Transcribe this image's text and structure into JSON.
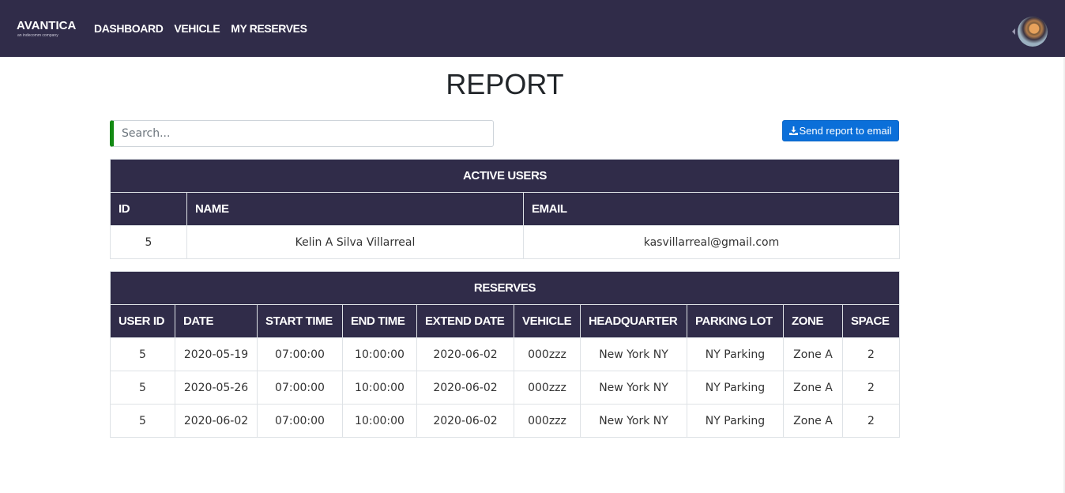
{
  "nav": {
    "logo": "AVANTICA",
    "logo_tagline": "an indecomm company",
    "links": [
      "DASHBOARD",
      "VEHICLE",
      "MY RESERVES"
    ]
  },
  "page": {
    "title": "REPORT"
  },
  "search": {
    "placeholder": "Search...",
    "value": ""
  },
  "send_button": {
    "label": "Send report to email",
    "icon": "download-icon"
  },
  "users_table": {
    "caption": "ACTIVE USERS",
    "columns": [
      "ID",
      "NAME",
      "EMAIL"
    ],
    "rows": [
      [
        "5",
        "Kelin A Silva Villarreal",
        "kasvillarreal@gmail.com"
      ]
    ]
  },
  "reserves_table": {
    "caption": "RESERVES",
    "columns": [
      "USER ID",
      "DATE",
      "START TIME",
      "END TIME",
      "EXTEND DATE",
      "VEHICLE",
      "HEADQUARTER",
      "PARKING LOT",
      "ZONE",
      "SPACE"
    ],
    "rows": [
      [
        "5",
        "2020-05-19",
        "07:00:00",
        "10:00:00",
        "2020-06-02",
        "000zzz",
        "New York NY",
        "NY Parking",
        "Zone A",
        "2"
      ],
      [
        "5",
        "2020-05-26",
        "07:00:00",
        "10:00:00",
        "2020-06-02",
        "000zzz",
        "New York NY",
        "NY Parking",
        "Zone A",
        "2"
      ],
      [
        "5",
        "2020-06-02",
        "07:00:00",
        "10:00:00",
        "2020-06-02",
        "000zzz",
        "New York NY",
        "NY Parking",
        "Zone A",
        "2"
      ]
    ]
  },
  "colors": {
    "navbar": "#302c49",
    "table_header": "#302c49",
    "button": "#0b6fd9",
    "search_accent": "#138a13"
  }
}
